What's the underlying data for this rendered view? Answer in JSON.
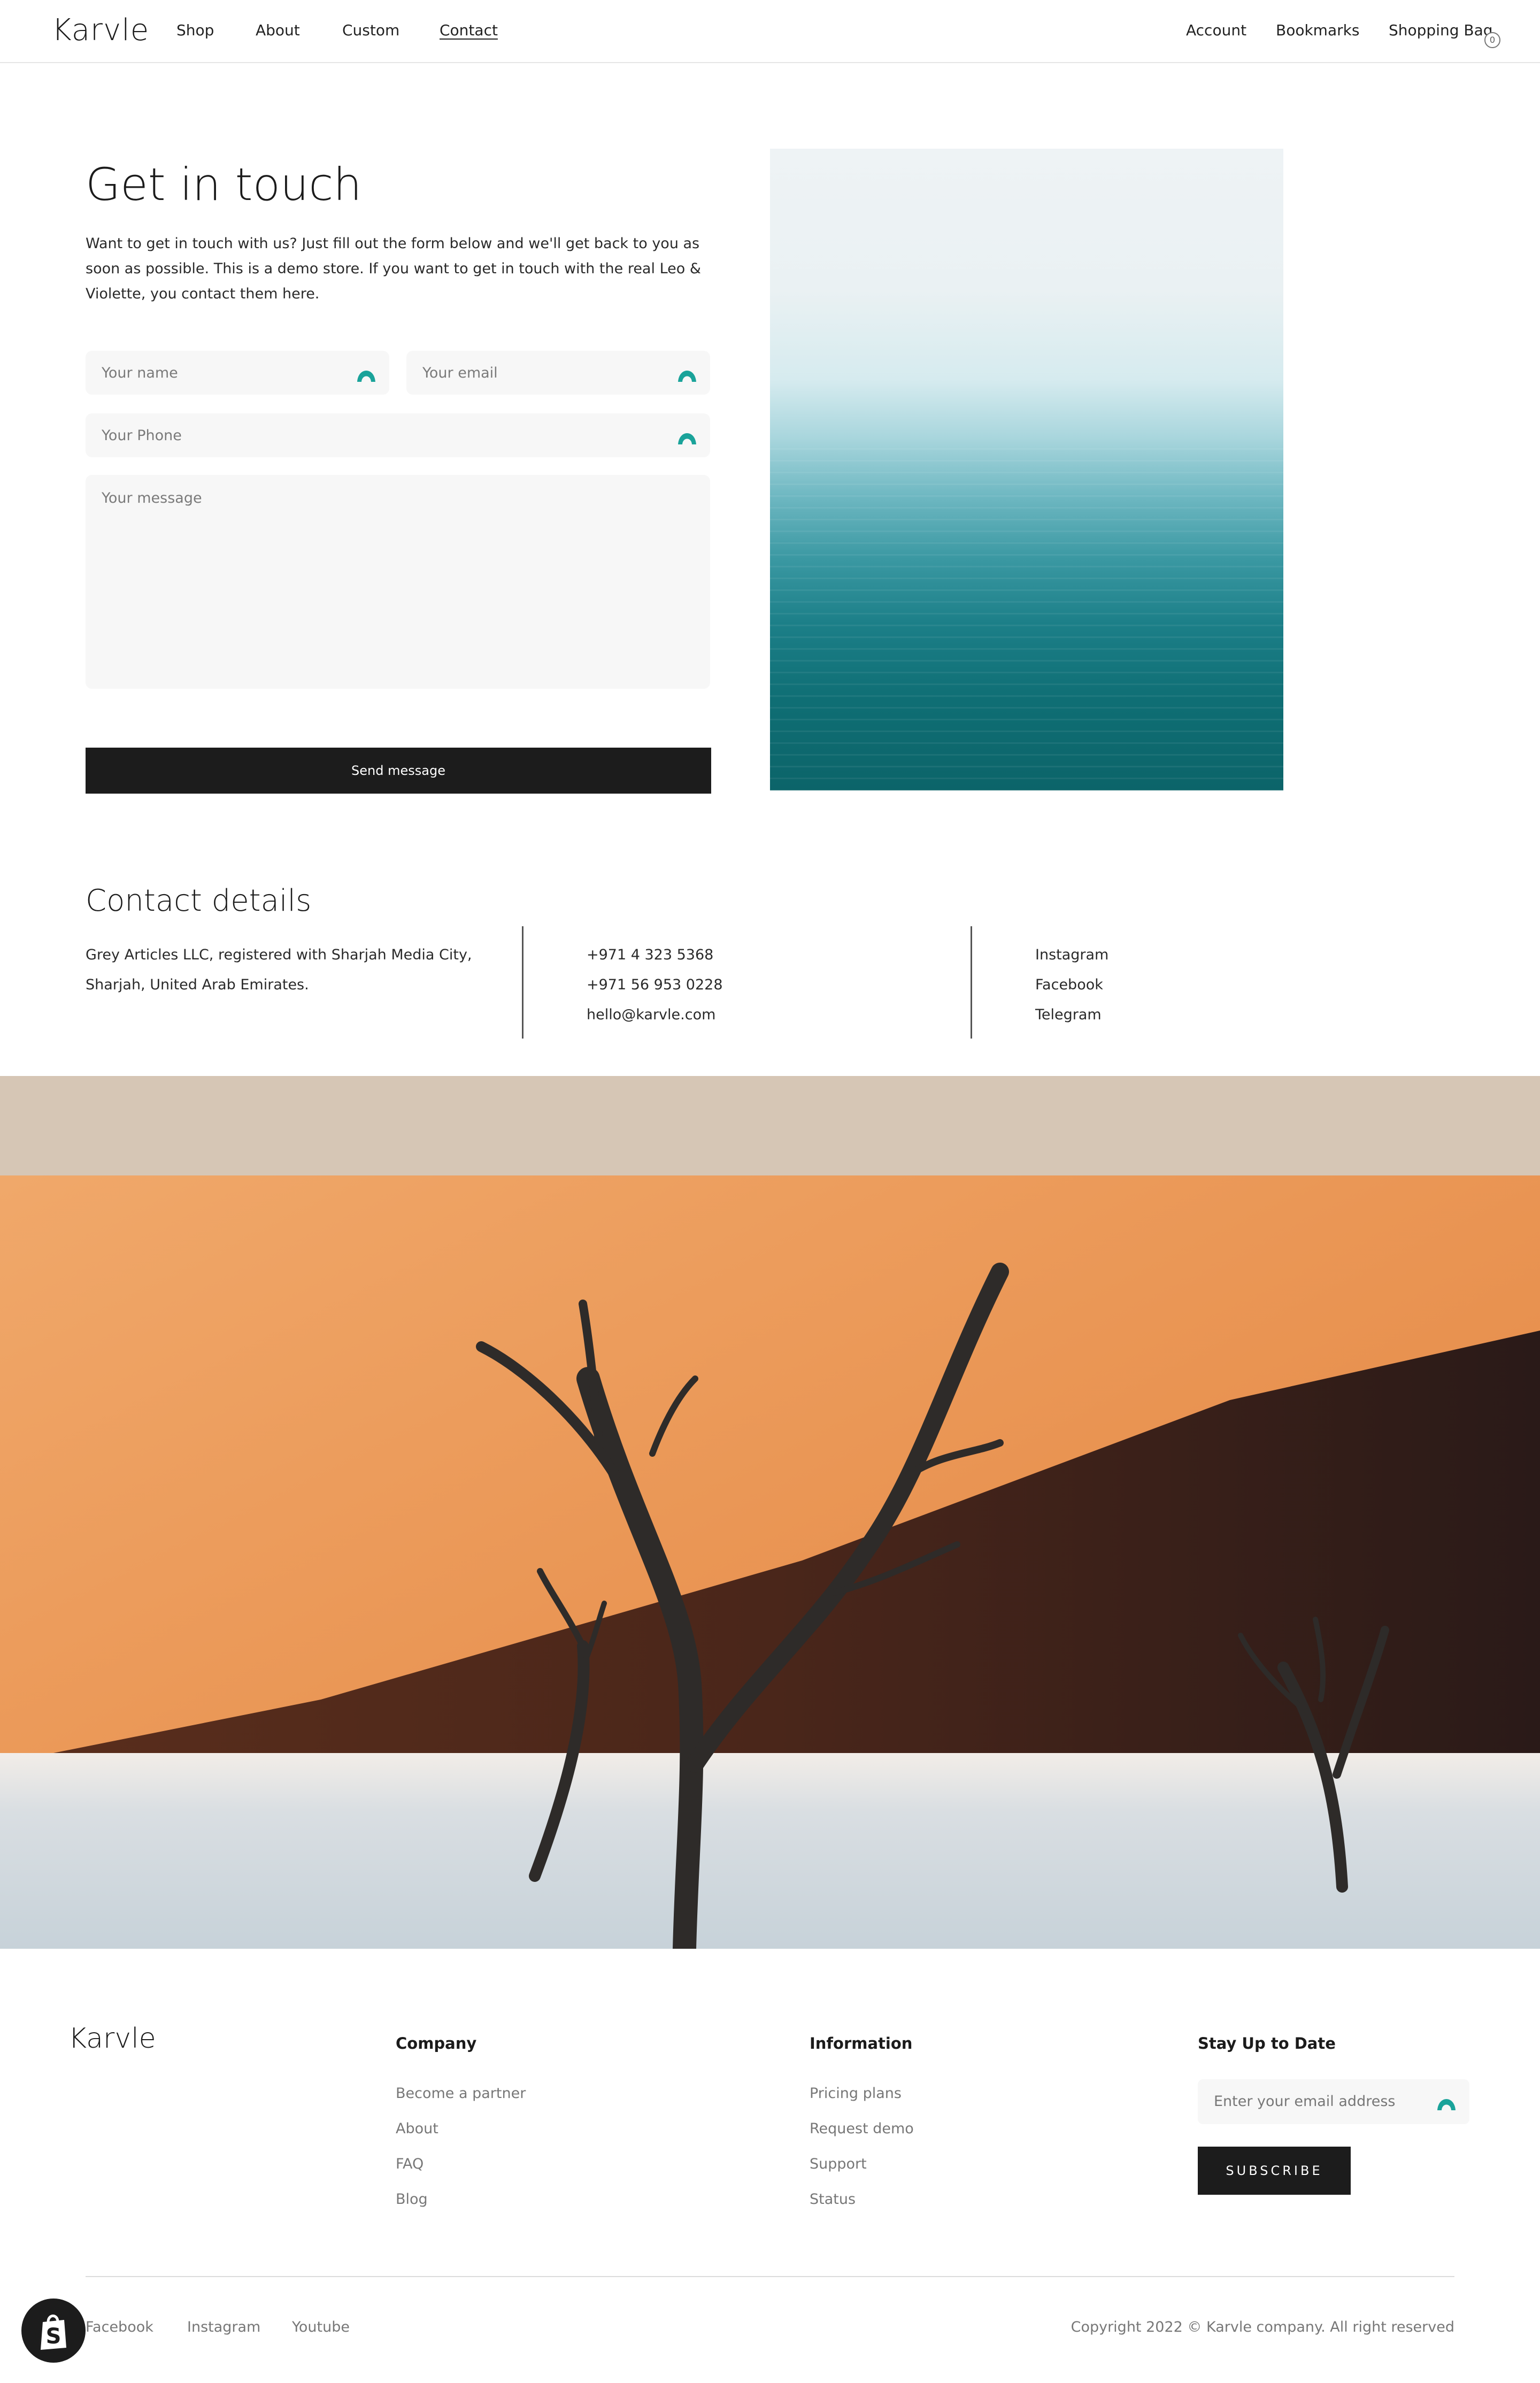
{
  "header": {
    "logo": "Karvle",
    "nav_left": [
      "Shop",
      "About",
      "Custom",
      "Contact"
    ],
    "nav_right": [
      "Account",
      "Bookmarks",
      "Shopping Bag"
    ],
    "bag_count": "0"
  },
  "contact_form": {
    "title": "Get in touch",
    "intro": "Want to get in touch with us? Just fill out the form below and we'll get back to you as soon as possible. This is a demo store. If you want to get in touch with the real Leo & Violette, you contact them here.",
    "name_placeholder": "Your name",
    "email_placeholder": "Your email",
    "phone_placeholder": "Your Phone",
    "message_placeholder": "Your message",
    "submit_label": "Send message"
  },
  "contact_details": {
    "title": "Contact details",
    "address": "Grey Articles LLC, registered with Sharjah Media City, Sharjah, United Arab Emirates.",
    "phones": [
      "+971 4 323 5368",
      "+971 56 953 0228",
      "hello@karvle.com"
    ],
    "socials": [
      "Instagram",
      "Facebook",
      "Telegram"
    ]
  },
  "footer": {
    "logo": "Karvle",
    "company": {
      "title": "Company",
      "links": [
        "Become a partner",
        "About",
        "FAQ",
        "Blog"
      ]
    },
    "information": {
      "title": "Information",
      "links": [
        "Pricing plans",
        "Request demo",
        "Support",
        "Status"
      ]
    },
    "newsletter": {
      "title": "Stay Up to Date",
      "placeholder": "Enter your email address",
      "button": "SUBSCRIBE"
    },
    "socials": [
      "Facebook",
      "Instagram",
      "Youtube"
    ],
    "copyright": "Copyright 2022 © Karvle company. All right reserved"
  },
  "colors": {
    "accent": "#1aa39a",
    "button_dark": "#1c1c1c",
    "banner_beige": "#d6c6b5"
  },
  "icons": {
    "field_icon": "teal-arch-icon",
    "shopify": "shopify-bag-icon"
  }
}
